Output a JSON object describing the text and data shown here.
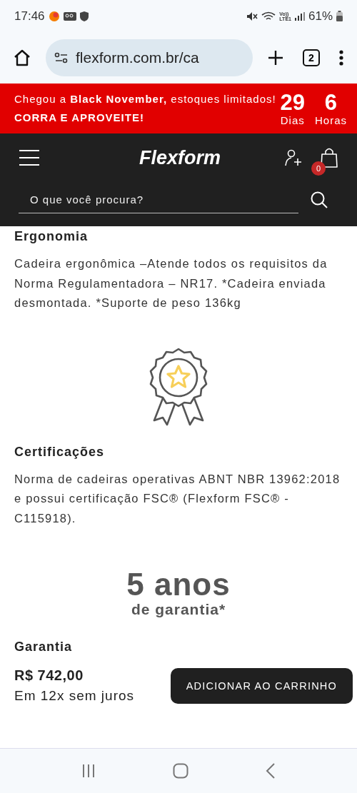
{
  "status_bar": {
    "time": "17:46",
    "volte": "Vo))",
    "lte": "LTE1",
    "battery": "61%"
  },
  "browser": {
    "url": "flexform.com.br/ca",
    "tab_count": "2"
  },
  "promo": {
    "text": "Chegou a **Black November,** estoques limitados! **CORRA E APROVEITE!**",
    "countdown": [
      {
        "value": "29",
        "unit": "Dias"
      },
      {
        "value": "6",
        "unit": "Horas"
      }
    ]
  },
  "header": {
    "logo": "Flexform",
    "cart_count": "0",
    "search": {
      "placeholder": "O que você procura?"
    }
  },
  "content": [
    {
      "kind": "section",
      "title": "Ergonomia",
      "body": "Cadeira ergonômica –Atende todos os requisitos da Norma Regulamentadora – NR17. *Cadeira enviada desmontada. *Suporte de peso 136kg"
    },
    {
      "kind": "award"
    },
    {
      "kind": "section",
      "title": "Certificações",
      "body": "Norma de cadeiras operativas ABNT NBR 13962:2018 e possui certificação FSC® (Flexform FSC® - C115918)."
    },
    {
      "kind": "warranty",
      "big": "5 anos",
      "small": "de garantia*"
    },
    {
      "kind": "heading",
      "title": "Garantia"
    }
  ],
  "purchase": {
    "price": "R$ 742,00",
    "installments": "Em 12x sem juros",
    "button": "ADICIONAR AO CARRINHO"
  }
}
